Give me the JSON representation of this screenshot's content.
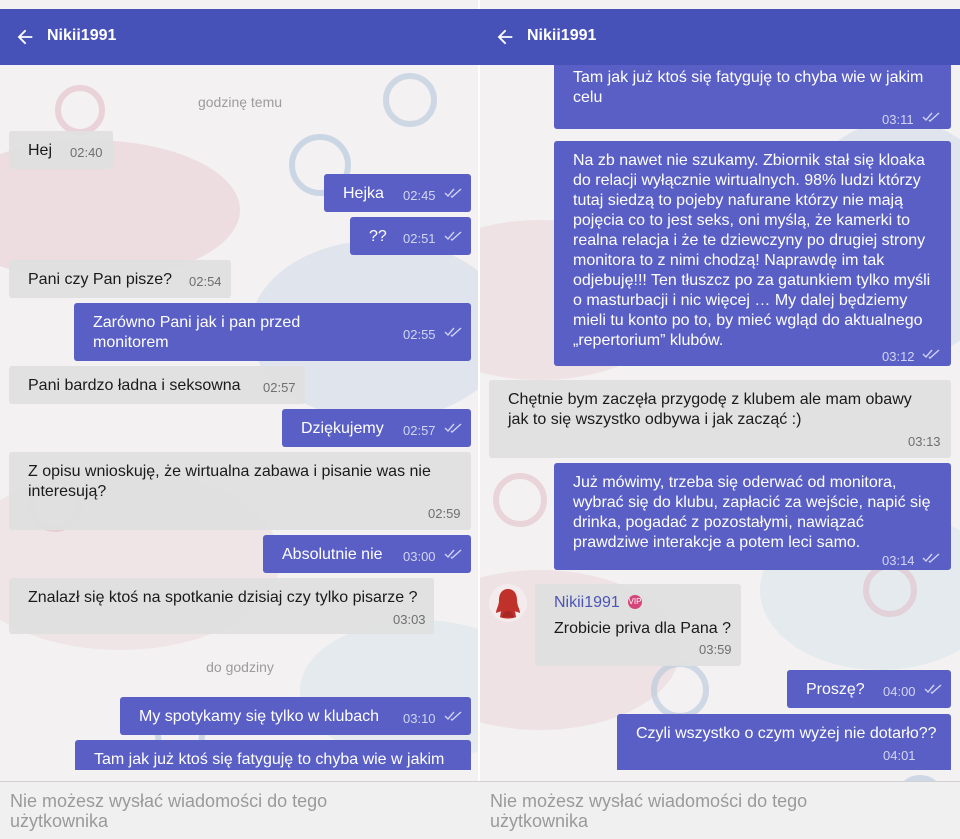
{
  "colors": {
    "header": "#4752b8",
    "outgoing": "#5a5fc6",
    "incoming": "#e0e0e0",
    "background": "#f3f1f1"
  },
  "icons": {
    "back": "arrow-left-icon",
    "read": "double-check-icon",
    "avatar": "woman-silhouette-icon",
    "badge": "vip-badge-icon"
  },
  "left": {
    "title": "Nikii1991",
    "dividers": [
      "godzinę temu",
      "do godziny"
    ],
    "messages": [
      {
        "dir": "in",
        "text": [
          "Hej"
        ],
        "time": "02:40"
      },
      {
        "dir": "out",
        "text": [
          "Hejka"
        ],
        "time": "02:45"
      },
      {
        "dir": "out",
        "text": [
          "??"
        ],
        "time": "02:51"
      },
      {
        "dir": "in",
        "text": [
          "Pani czy Pan pisze?"
        ],
        "time": "02:54"
      },
      {
        "dir": "out",
        "text": [
          "Zarówno Pani jak i pan przed",
          "monitorem"
        ],
        "time": "02:55"
      },
      {
        "dir": "in",
        "text": [
          "Pani bardzo ładna i seksowna"
        ],
        "time": "02:57"
      },
      {
        "dir": "out",
        "text": [
          "Dziękujemy"
        ],
        "time": "02:57"
      },
      {
        "dir": "in",
        "text": [
          "Z opisu wnioskuję, że wirtualna zabawa i pisanie was nie",
          "interesują?"
        ],
        "time": "02:59"
      },
      {
        "dir": "out",
        "text": [
          "Absolutnie nie"
        ],
        "time": "03:00"
      },
      {
        "dir": "in",
        "text": [
          "Znalazł się ktoś na spotkanie dzisiaj czy tylko pisarze ?"
        ],
        "time": "03:03"
      },
      {
        "dir": "out",
        "text": [
          "My spotykamy się tylko w klubach"
        ],
        "time": "03:10"
      },
      {
        "dir": "out",
        "text": [
          "Tam jak już ktoś się fatyguję to chyba wie w jakim"
        ],
        "time": ""
      }
    ],
    "input_placeholder": [
      "Nie możesz wysłać wiadomości do tego",
      "użytkownika"
    ]
  },
  "right": {
    "title": "Nikii1991",
    "messages": [
      {
        "dir": "out",
        "text": [
          "Tam jak już ktoś się fatyguję to chyba wie w jakim",
          "celu"
        ],
        "time": "03:11"
      },
      {
        "dir": "out",
        "text": [
          "Na zb nawet nie szukamy. Zbiornik stał się kloaka",
          "do relacji wyłącznie wirtualnych. 98% ludzi którzy",
          "tutaj siedzą to pojeby nafurane którzy nie mają",
          "pojęcia co to jest seks, oni myślą, że kamerki to",
          "realna relacja i że te dziewczyny po drugiej strony",
          "monitora to z nimi chodzą! Naprawdę im tak",
          "odjebuję!!! Ten tłuszcz po za gatunkiem tylko myśli",
          "o masturbacji i nic więcej … My dalej będziemy",
          "mieli tu konto po to, by mieć wgląd do aktualnego",
          "„repertorium” klubów."
        ],
        "time": "03:12"
      },
      {
        "dir": "in",
        "text": [
          "Chętnie bym zaczęła przygodę z klubem ale mam obawy",
          "jak to się wszystko odbywa i jak zacząć :)"
        ],
        "time": "03:13"
      },
      {
        "dir": "out",
        "text": [
          "Już mówimy, trzeba się oderwać od monitora,",
          "wybrać się do klubu, zapłacić za wejście, napić się",
          "drinka, pogadać z pozostałymi, nawiązać",
          "prawdziwe interakcje a potem leci samo."
        ],
        "time": "03:14"
      },
      {
        "dir": "in",
        "sender": "Nikii1991",
        "badge": "VIP",
        "text": [
          "Zrobicie priva dla Pana ?"
        ],
        "time": "03:59"
      },
      {
        "dir": "out",
        "text": [
          "Proszę?"
        ],
        "time": "04:00"
      },
      {
        "dir": "out",
        "text": [
          "Czyli wszystko o czym wyżej nie dotarło??"
        ],
        "time": "04:01"
      }
    ],
    "input_placeholder": [
      "Nie możesz wysłać wiadomości do tego",
      "użytkownika"
    ]
  }
}
